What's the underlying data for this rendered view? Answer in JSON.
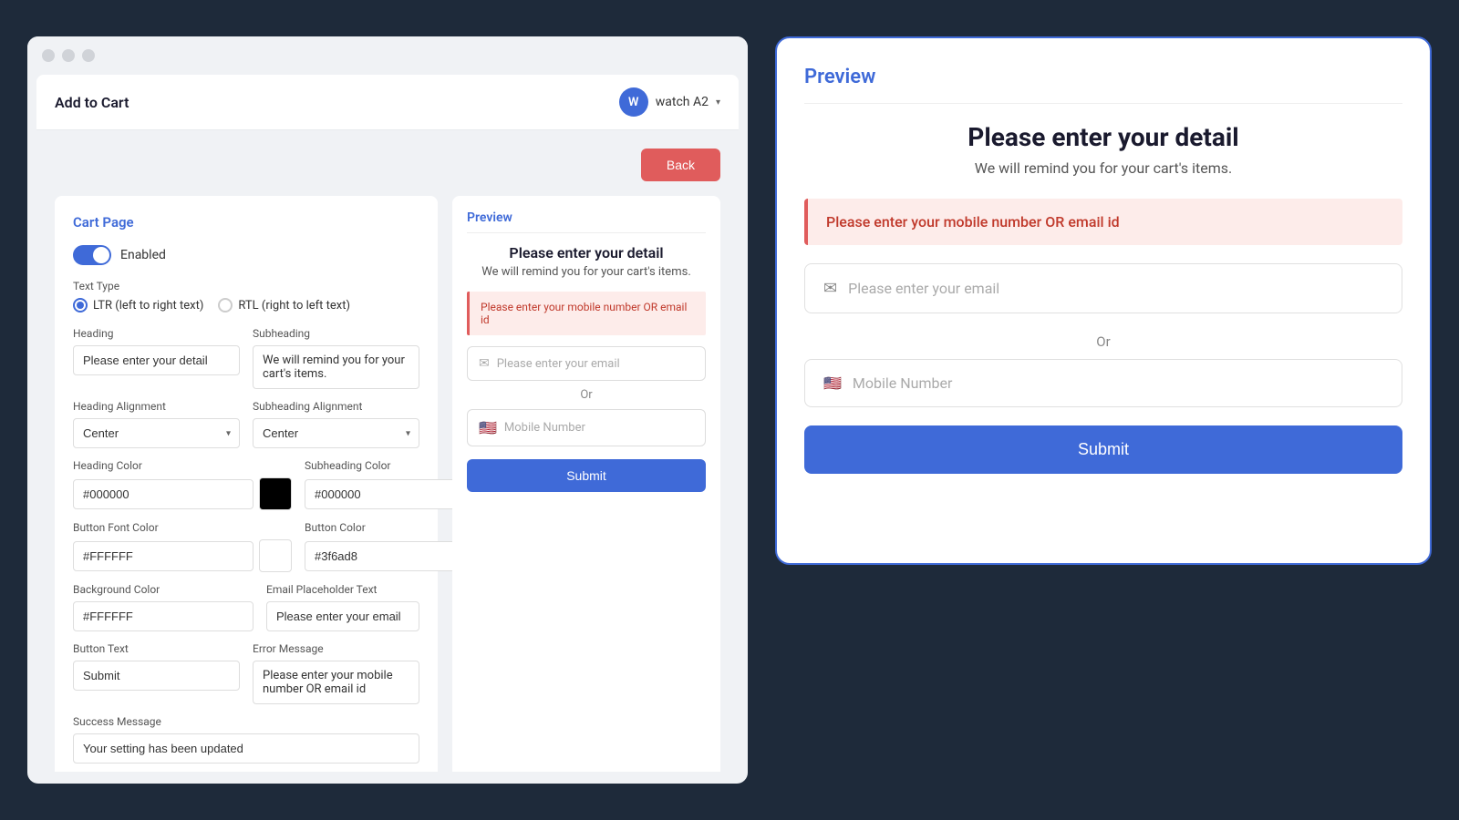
{
  "browser": {
    "dots": [
      "dot1",
      "dot2",
      "dot3"
    ]
  },
  "header": {
    "title": "Add to Cart",
    "user_initial": "W",
    "user_name": "watch A2",
    "chevron": "▾"
  },
  "back_button": {
    "label": "Back"
  },
  "settings_panel": {
    "title": "Cart Page",
    "toggle_label": "Enabled",
    "text_type_label": "Text Type",
    "ltr_label": "LTR (left to right text)",
    "rtl_label": "RTL (right to left text)",
    "heading_label": "Heading",
    "heading_value": "Please enter your detail",
    "subheading_label": "Subheading",
    "subheading_value": "We will remind you for your cart's items.",
    "heading_align_label": "Heading Alignment",
    "heading_align_value": "Center",
    "subheading_align_label": "Subheading Alignment",
    "subheading_align_value": "Center",
    "heading_color_label": "Heading Color",
    "heading_color_value": "#000000",
    "heading_color_swatch": "#000000",
    "subheading_color_label": "Subheading Color",
    "subheading_color_value": "#000000",
    "subheading_color_swatch": "#000000",
    "btn_font_color_label": "Button Font Color",
    "btn_font_color_value": "#FFFFFF",
    "btn_font_color_swatch": "#FFFFFF",
    "btn_color_label": "Button Color",
    "btn_color_value": "#3f6ad8",
    "btn_color_swatch": "#3f6ad8",
    "bg_color_label": "Background Color",
    "bg_color_value": "#FFFFFF",
    "bg_color_swatch": "#FFFFFF",
    "email_placeholder_label": "Email Placeholder Text",
    "email_placeholder_value": "Please enter your email",
    "button_text_label": "Button Text",
    "button_text_value": "Submit",
    "error_message_label": "Error Message",
    "error_message_value": "Please enter your mobile number OR email id",
    "success_message_label": "Success Message",
    "success_message_value": "Your setting has been updated"
  },
  "preview_small": {
    "title": "Preview",
    "heading": "Please enter your detail",
    "subheading": "We will remind you for your cart's items.",
    "error_text": "Please enter your mobile number OR email id",
    "email_placeholder": "Please enter your email",
    "or_text": "Or",
    "phone_placeholder": "Mobile Number",
    "submit_label": "Submit",
    "flag": "🇺🇸"
  },
  "preview_large": {
    "title": "Preview",
    "heading": "Please enter your detail",
    "subheading": "We will remind you for your cart's items.",
    "error_text": "Please enter your mobile number OR email id",
    "email_placeholder": "Please enter your email",
    "or_text": "Or",
    "phone_placeholder": "Mobile Number",
    "submit_label": "Submit",
    "flag": "🇺🇸"
  },
  "colors": {
    "accent": "#3f6ad8",
    "error_bg": "#fdecea",
    "error_text": "#c0392b",
    "error_border": "#e05c5c"
  }
}
